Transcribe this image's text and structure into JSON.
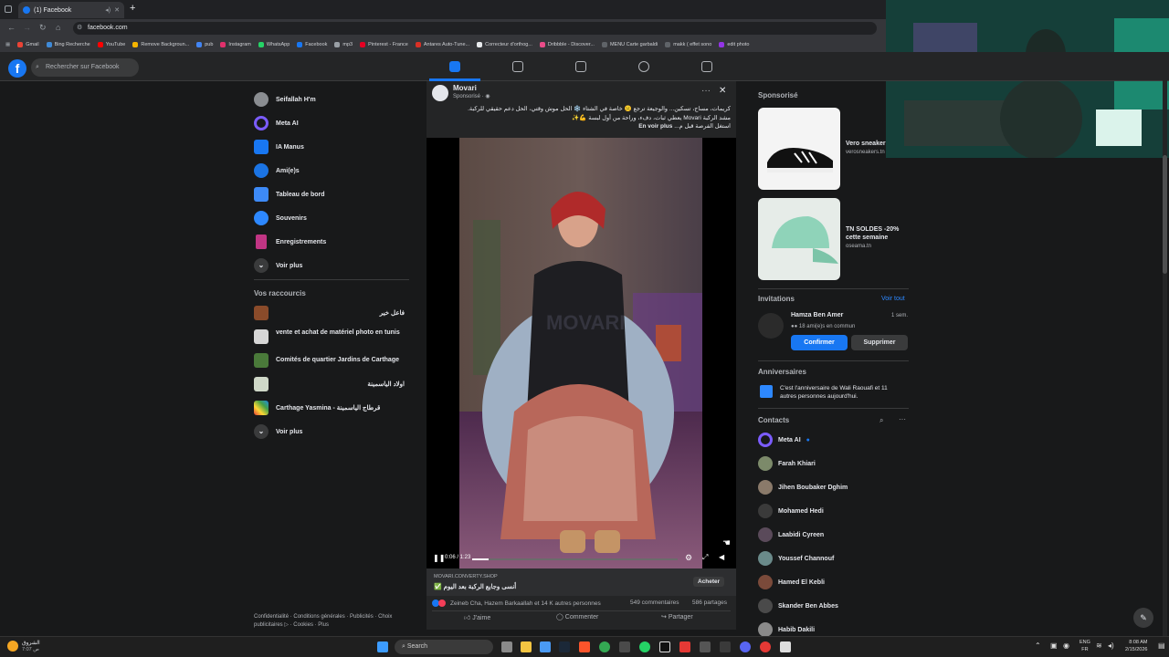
{
  "browser": {
    "tab_title": "(1) Facebook",
    "url": "facebook.com",
    "bookmarks": [
      "Gmail",
      "Bing Recherche",
      "YouTube",
      "Remove Backgroun...",
      "pub",
      "Instagram",
      "WhatsApp",
      "Facebook",
      "mp3",
      "Pinterest - France",
      "Antares Auto-Tune...",
      "Correcteur d'orthog...",
      "Dribbble - Discover...",
      "MENU Carte garbaldi",
      "makk ( effet sono",
      "edit photo"
    ]
  },
  "header": {
    "search_placeholder": "Rechercher sur Facebook"
  },
  "left_nav": {
    "items": [
      {
        "label": "Seifallah H'm"
      },
      {
        "label": "Meta AI"
      },
      {
        "label": "IA Manus"
      },
      {
        "label": "Ami(e)s"
      },
      {
        "label": "Tableau de bord"
      },
      {
        "label": "Souvenirs"
      },
      {
        "label": "Enregistrements"
      },
      {
        "label": "Voir plus"
      }
    ],
    "shortcuts_title": "Vos raccourcis",
    "shortcuts": [
      {
        "label": "فاعل خير"
      },
      {
        "label": "vente et achat de matériel photo en tunis"
      },
      {
        "label": "Comités de quartier Jardins de Carthage"
      },
      {
        "label": "اولاد الياسمينة"
      },
      {
        "label": "Carthage Yasmina - قرطاج الياسمينة"
      },
      {
        "label": "Voir plus"
      }
    ],
    "footer": "Confidentialité · Conditions générales · Publicités · Choix publicitaires ▷ · Cookies · Plus"
  },
  "post": {
    "author": "Movari",
    "sponsored": "Sponsorisé · ",
    "text_line1": "كريمات، مساج، تسكين... والوجيعة ترجع ☹️ خاصة في الشتاء ❄️ الحل موش وقتي، الحل دعم حقيقي للركبة.",
    "text_line2": "مشد الركبة Movari يعطي ثبات، دفء، وراحة من أول لبسة 💪✨",
    "text_line3": "استغل الفرصة قبل م...",
    "see_more": "En voir plus",
    "video_watermark": "MOVARI",
    "video_time": "0:06 / 1:23",
    "domain": "MOVARI.CONVERTY.SHOP",
    "headline": "✅ أنسى وجايع الركبة بعد اليوم",
    "cta": "Acheter",
    "reactions": "Zeineb Cha, Hazem Barkaallah et 14 K autres personnes",
    "comments": "549 commentaires",
    "shares": "586 partages",
    "like": "J'aime",
    "comment": "Commenter",
    "share": "Partager"
  },
  "right": {
    "sponsored_title": "Sponsorisé",
    "ads": [
      {
        "title": "Vero sneaker",
        "domain": "verosneakers.tn"
      },
      {
        "title": "TN SOLDES -20% cette semaine",
        "domain": "oseama.tn"
      }
    ],
    "invitations_title": "Invitations",
    "see_all": "Voir tout",
    "invite_name": "Hamza Ben Amer",
    "invite_time": "1 sem.",
    "invite_mutual": "18 ami(e)s en commun",
    "confirm": "Confirmer",
    "delete": "Supprimer",
    "birthdays_title": "Anniversaires",
    "birthday_text": "C'est l'anniversaire de Wali Raouafi et 11 autres personnes aujourd'hui.",
    "contacts_title": "Contacts",
    "contacts": [
      {
        "name": "Meta AI"
      },
      {
        "name": "Farah Khiari"
      },
      {
        "name": "Jihen Boubaker Dghim"
      },
      {
        "name": "Mohamed Hedi"
      },
      {
        "name": "Laabidi Cyreen"
      },
      {
        "name": "Youssef Channouf"
      },
      {
        "name": "Hamed El Kebli"
      },
      {
        "name": "Skander Ben Abbes"
      },
      {
        "name": "Habib Dakili"
      }
    ]
  },
  "taskbar": {
    "weather_text": "الشروق",
    "weather_sub": "ص 7:07",
    "search": "Search",
    "lang": "ENG",
    "lang_sub": "FR",
    "time": "8:08 AM",
    "date": "2/15/2026"
  },
  "colors": {
    "fb_blue": "#1877f2",
    "bg": "#18191a",
    "card": "#242526"
  }
}
